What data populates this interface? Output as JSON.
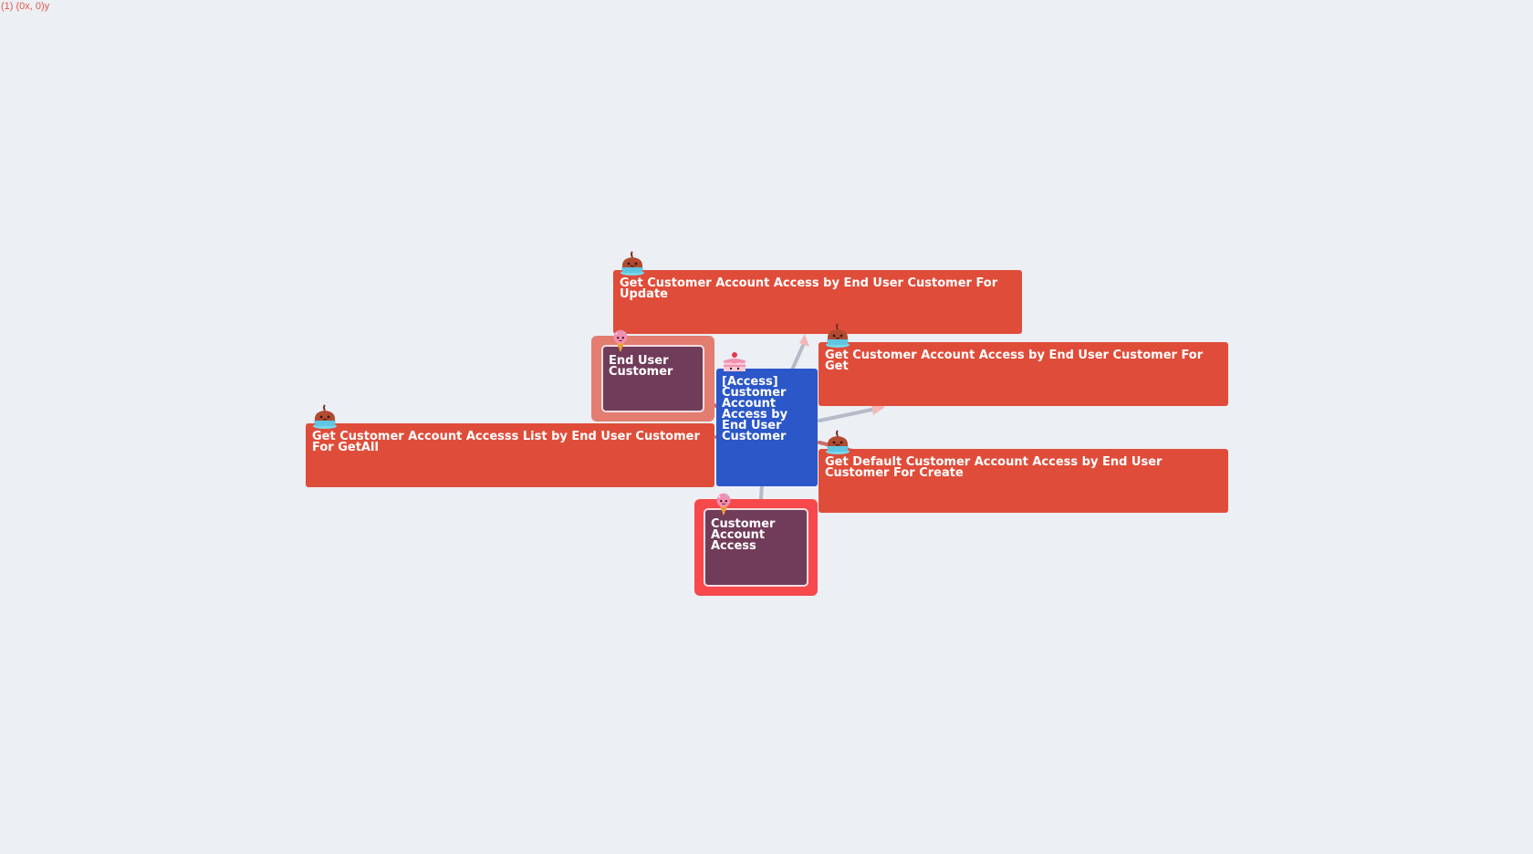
{
  "coordinate_readout": "(1) (0x, 0)y",
  "colors": {
    "background": "#ECEFF4",
    "query_node": "#DF4D3A",
    "center_node": "#2B57C8",
    "entity_fill": "#713C59",
    "entity_border_light": "#E27D70",
    "entity_border_strong": "#F7494B",
    "coordinate_text": "#E05A4A",
    "edge_gray": "#B5BBC6",
    "edge_red": "#C86D6D",
    "arrow_pink": "#F4B7B7"
  },
  "nodes": {
    "update": {
      "label": "Get Customer Account Access by End User Customer For Update",
      "icon": "cupcake-chocolate-icon"
    },
    "get": {
      "label": "Get Customer Account Access by End User Customer For Get",
      "icon": "cupcake-chocolate-icon"
    },
    "get_all": {
      "label": "Get Customer Account Accesss List by End User Customer For GetAll",
      "icon": "cupcake-chocolate-icon"
    },
    "create": {
      "label": "Get Default Customer Account Access by End User Customer For Create",
      "icon": "cupcake-chocolate-icon"
    },
    "center": {
      "label": "[Access] Customer Account Access by End User Customer",
      "icon": "strawberry-cake-icon"
    },
    "end_user_customer": {
      "label": "End User Customer",
      "icon": "ice-cream-icon"
    },
    "customer_account_access": {
      "label": "Customer Account Access",
      "icon": "ice-cream-icon"
    }
  }
}
